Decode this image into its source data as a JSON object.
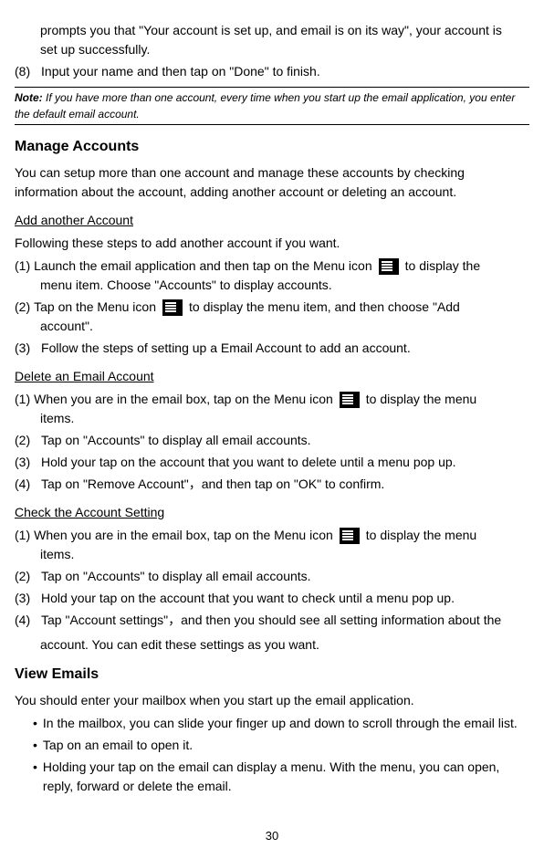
{
  "top_steps": {
    "cont_line1": "prompts you that \"Your account is set up, and email is on its way\", your account is",
    "cont_line2": "set up successfully.",
    "step8_num": "(8)",
    "step8_text": "Input your name and then tap on \"Done\" to finish."
  },
  "note": {
    "label": "Note:",
    "text": "If you have more than one account, every time when you start up the email application, you enter the default email account."
  },
  "manage_accounts": {
    "heading": "Manage Accounts",
    "intro": "You can setup more than one account and manage these accounts by checking information about the account, adding another account or deleting an account.",
    "add_heading": "Add another Account",
    "add_intro": "Following these steps to add another account if you want.",
    "add_steps": {
      "s1_num": "(1)",
      "s1_a": "Launch the email application and then tap on the Menu icon",
      "s1_b": "to display the",
      "s1_c": "menu item. Choose \"Accounts\" to display accounts.",
      "s2_num": "(2)",
      "s2_a": "Tap on the Menu icon",
      "s2_b": "to display the menu item, and then choose \"Add",
      "s2_c": "account\".",
      "s3_num": "(3)",
      "s3_text": "Follow the steps of setting up a Email Account to add an account."
    },
    "delete_heading": "Delete an Email Account",
    "delete_steps": {
      "s1_num": "(1)",
      "s1_a": "When you are in the email box, tap on the Menu icon",
      "s1_b": "to display the menu",
      "s1_c": "items.",
      "s2_num": "(2)",
      "s2_text": "Tap on \"Accounts\" to display all email accounts.",
      "s3_num": "(3)",
      "s3_text": "Hold your tap on the account that you want to delete until a menu pop up.",
      "s4_num": "(4)",
      "s4_text": "Tap on \"Remove Account\"，and then tap on \"OK\" to confirm."
    },
    "check_heading": "Check the Account Setting",
    "check_steps": {
      "s1_num": "(1)",
      "s1_a": "When you are in the email box, tap on the Menu icon",
      "s1_b": "to display the menu",
      "s1_c": "items.",
      "s2_num": "(2)",
      "s2_text": "Tap on \"Accounts\" to display all email accounts.",
      "s3_num": "(3)",
      "s3_text": "Hold your tap on the account that you want to check until a menu pop up.",
      "s4_num": "(4)",
      "s4_a": "Tap \"Account settings\"，and then you should see all setting information about the",
      "s4_b": "account. You can edit these settings as you want."
    }
  },
  "view_emails": {
    "heading": "View Emails",
    "intro": "You should enter your mailbox when you start up the email application.",
    "bullets": {
      "b1": "In the mailbox, you can slide your finger up and down to scroll through the email list.",
      "b2": "Tap on an email to open it.",
      "b3": "Holding your tap on the email can display a menu. With the menu, you can open, reply, forward or delete the email."
    }
  },
  "page_number": "30",
  "bullet_char": "•"
}
